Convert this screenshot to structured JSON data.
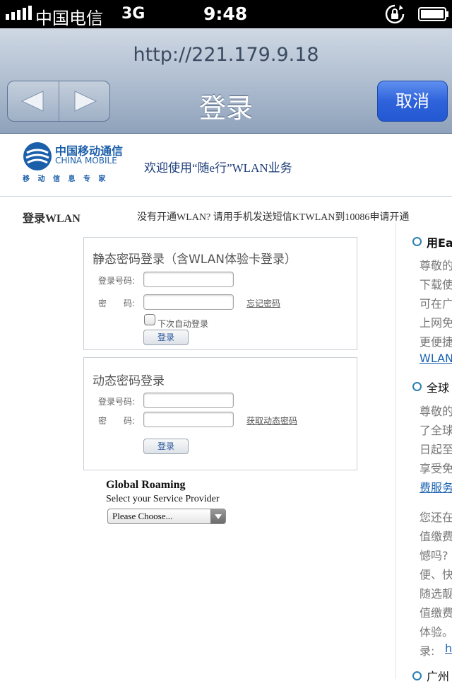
{
  "status": {
    "carrier": "中国电信",
    "network": "3G",
    "time": "9:48",
    "icons": [
      "signal-icon",
      "rotation-lock-icon",
      "battery-icon"
    ]
  },
  "nav": {
    "url": "http://221.179.9.18",
    "title": "登录",
    "cancel_label": "取消"
  },
  "header": {
    "logo_cn": "中国移动通信",
    "logo_en": "CHINA MOBILE",
    "logo_tagline": "移 动 信 息 专 家",
    "welcome": "欢迎使用“随e行”WLAN业务"
  },
  "login": {
    "heading": "登录WLAN",
    "hint": "没有开通WLAN? 请用手机发送短信KTWLAN到10086申请开通",
    "static_panel": {
      "title": "静态密码登录（含WLAN体验卡登录）",
      "account_label": "登录号码:",
      "password_label": "密　　码:",
      "forgot_link": "忘记密码",
      "remember_label": "下次自动登录",
      "submit_label": "登录"
    },
    "dynamic_panel": {
      "title": "动态密码登录",
      "account_label": "登录号码:",
      "password_label": "密　　码:",
      "get_code_link": "获取动态密码",
      "submit_label": "登录"
    }
  },
  "roaming": {
    "title": "Global Roaming",
    "subtitle": "Select your Service Provider",
    "select_value": "Please Choose..."
  },
  "sidebar": {
    "sections": [
      {
        "heading": "用Ea",
        "lines": [
          "尊敬的",
          "下载使",
          "可在广",
          "上网免",
          "更便捷"
        ],
        "link": "WLAN"
      },
      {
        "heading": "全球",
        "lines": [
          "尊敬的",
          "了全球",
          "日起至",
          "享受免"
        ],
        "link": "费服务"
      },
      {
        "heading": "",
        "lines": [
          "您还在",
          "值缴费",
          "憾吗?",
          "便、快",
          "随选靓",
          "值缴费",
          "体验。",
          "录: "
        ],
        "link": "h"
      },
      {
        "heading": "广州",
        "lines": [],
        "link": ""
      }
    ]
  },
  "colors": {
    "nav_gradient_top": "#cfd8e3",
    "nav_gradient_bottom": "#8fa2bb",
    "cancel_blue": "#2f63db",
    "brand_blue": "#1d3d7a",
    "link_blue": "#1a63b2",
    "bullet_blue": "#2b7fb3"
  }
}
